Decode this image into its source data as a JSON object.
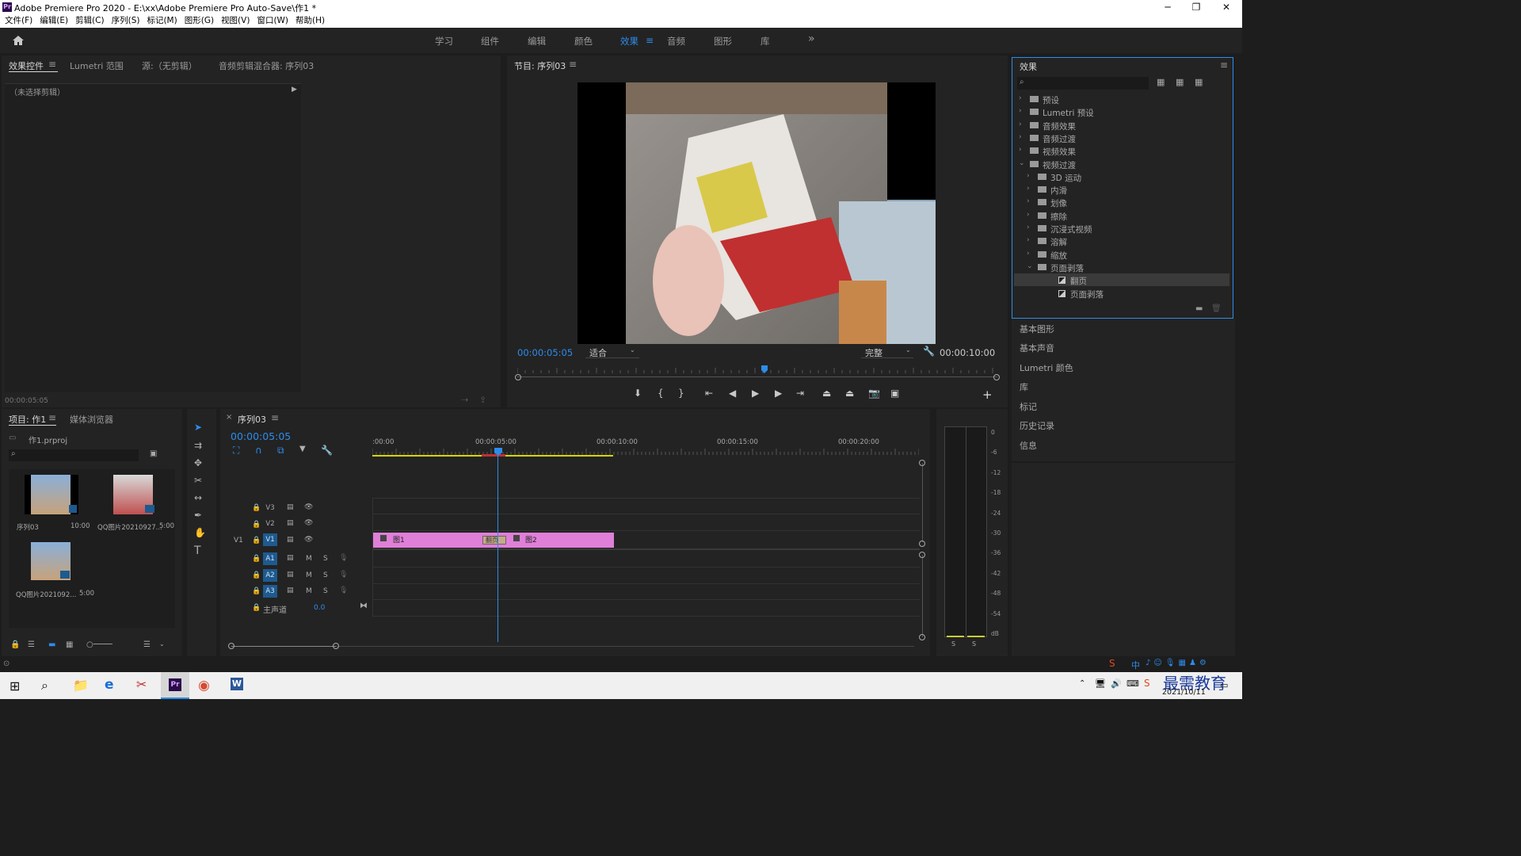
{
  "window": {
    "title": "Adobe Premiere Pro 2020 - E:\\xx\\Adobe Premiere Pro Auto-Save\\作1 *",
    "app_icon": "Pr",
    "controls": {
      "minimize": "─",
      "maximize": "❐",
      "close": "✕"
    }
  },
  "menu": [
    "文件(F)",
    "编辑(E)",
    "剪辑(C)",
    "序列(S)",
    "标记(M)",
    "图形(G)",
    "视图(V)",
    "窗口(W)",
    "帮助(H)"
  ],
  "workspaces": {
    "items": [
      "学习",
      "组件",
      "编辑",
      "颜色",
      "效果",
      "音频",
      "图形",
      "库"
    ],
    "active": "效果",
    "more": "»"
  },
  "source_panel": {
    "tabs": [
      "效果控件",
      "Lumetri 范围",
      "源:（无剪辑）",
      "音频剪辑混合器: 序列03"
    ],
    "no_clip": "（未选择剪辑）",
    "timecode": "00:00:05:05"
  },
  "program_monitor": {
    "title": "节目: 序列03",
    "timecode": "00:00:05:05",
    "fit": "适合",
    "quality": "完整",
    "duration": "00:00:10:00",
    "playhead_fraction": 0.515
  },
  "effects_panel": {
    "title": "效果",
    "search_placeholder": "",
    "tree": [
      {
        "label": "预设",
        "level": 0,
        "open": false,
        "type": "star-folder"
      },
      {
        "label": "Lumetri 预设",
        "level": 0,
        "open": false,
        "type": "star-folder"
      },
      {
        "label": "音频效果",
        "level": 0,
        "open": false,
        "type": "folder"
      },
      {
        "label": "音频过渡",
        "level": 0,
        "open": false,
        "type": "folder"
      },
      {
        "label": "视频效果",
        "level": 0,
        "open": false,
        "type": "folder"
      },
      {
        "label": "视频过渡",
        "level": 0,
        "open": true,
        "type": "folder"
      },
      {
        "label": "3D 运动",
        "level": 1,
        "open": false,
        "type": "folder"
      },
      {
        "label": "内滑",
        "level": 1,
        "open": false,
        "type": "folder"
      },
      {
        "label": "划像",
        "level": 1,
        "open": false,
        "type": "folder"
      },
      {
        "label": "擦除",
        "level": 1,
        "open": false,
        "type": "folder"
      },
      {
        "label": "沉浸式视频",
        "level": 1,
        "open": false,
        "type": "folder"
      },
      {
        "label": "溶解",
        "level": 1,
        "open": false,
        "type": "folder"
      },
      {
        "label": "缩放",
        "level": 1,
        "open": false,
        "type": "folder"
      },
      {
        "label": "页面剥落",
        "level": 1,
        "open": true,
        "type": "folder"
      },
      {
        "label": "翻页",
        "level": 2,
        "open": false,
        "type": "effect",
        "selected": true
      },
      {
        "label": "页面剥落",
        "level": 2,
        "open": false,
        "type": "effect"
      }
    ]
  },
  "side_panels": [
    "基本图形",
    "基本声音",
    "Lumetri 颜色",
    "库",
    "标记",
    "历史记录",
    "信息"
  ],
  "project_panel": {
    "tabs": [
      "项目: 作1",
      "媒体浏览器"
    ],
    "file": "作1.prproj",
    "items": [
      {
        "name": "序列03",
        "duration": "10:00"
      },
      {
        "name": "QQ图片20210927...",
        "duration": "5:00"
      },
      {
        "name": "QQ图片2021092...",
        "duration": "5:00"
      }
    ]
  },
  "timeline": {
    "title": "序列03",
    "timecode": "00:00:05:05",
    "ruler": [
      ":00:00",
      "00:00:05:00",
      "00:00:10:00",
      "00:00:15:00",
      "00:00:20:00"
    ],
    "video_tracks": [
      "V3",
      "V2",
      "V1"
    ],
    "audio_tracks": [
      "A1",
      "A2",
      "A3"
    ],
    "source_patch": "V1",
    "audio_labels": {
      "mute": "M",
      "solo": "S"
    },
    "master": {
      "label": "主声道",
      "value": "0.0"
    },
    "clips": [
      {
        "name": "图1",
        "track": "V1"
      },
      {
        "name": "图2",
        "track": "V1"
      }
    ],
    "transition": "翻页",
    "colors": {
      "clip": "#e07fd8",
      "playhead": "#2d8ceb",
      "work_area": "#d4d400"
    }
  },
  "audio_meter": {
    "scale": [
      "0",
      "-6",
      "-12",
      "-18",
      "-24",
      "-30",
      "-36",
      "-42",
      "-48",
      "-54",
      "dB"
    ],
    "solo": [
      "S",
      "S"
    ]
  },
  "taskbar": {
    "date": "2021/10/11",
    "watermark": "最需教育",
    "ime": "中"
  },
  "colors": {
    "accent": "#2d8ceb",
    "panel_bg": "#232323",
    "bg": "#1d1d1d",
    "clip": "#e07fd8"
  }
}
